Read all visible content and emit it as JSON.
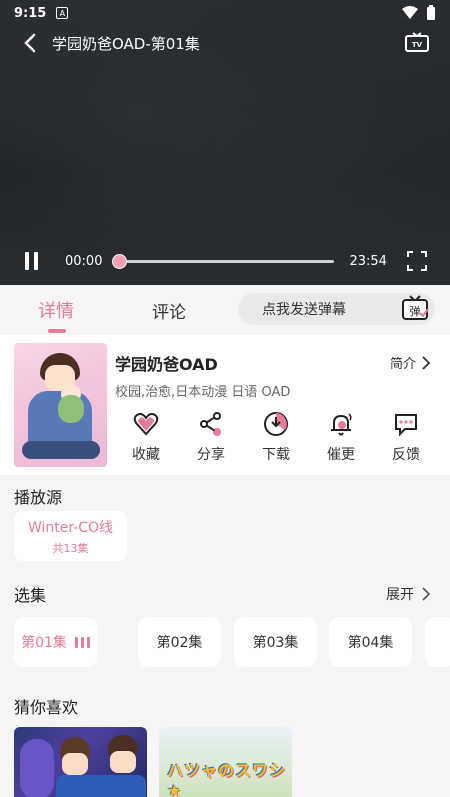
{
  "status_bar": {
    "time": "9:15",
    "notification_icon": "A"
  },
  "player": {
    "title": "学园奶爸OAD-第01集",
    "current_time": "00:00",
    "total_time": "23:54",
    "progress": 0.0,
    "accent_color": "#f1a3b5"
  },
  "tabs": {
    "detail": "详情",
    "comment": "评论",
    "danmu_placeholder": "点我发送弹幕",
    "danmu_icon_text": "弹"
  },
  "anime": {
    "title": "学园奶爸OAD",
    "intro_label": "简介",
    "tags": "校园,治愈,日本动漫 日语 OAD"
  },
  "actions": [
    {
      "label": "收藏",
      "icon": "heart-icon"
    },
    {
      "label": "分享",
      "icon": "share-icon"
    },
    {
      "label": "下载",
      "icon": "download-icon"
    },
    {
      "label": "催更",
      "icon": "bell-icon"
    },
    {
      "label": "反馈",
      "icon": "feedback-icon"
    }
  ],
  "source": {
    "section_title": "播放源",
    "name": "Winter-CO线",
    "count": "共13集"
  },
  "episodes": {
    "section_title": "选集",
    "expand_label": "展开",
    "items": [
      "第01集",
      "第02集",
      "第03集",
      "第04集"
    ],
    "active_index": 0
  },
  "recommend": {
    "section_title": "猜你喜欢"
  },
  "colors": {
    "accent": "#e87b98",
    "background": "#f5f5f5"
  }
}
